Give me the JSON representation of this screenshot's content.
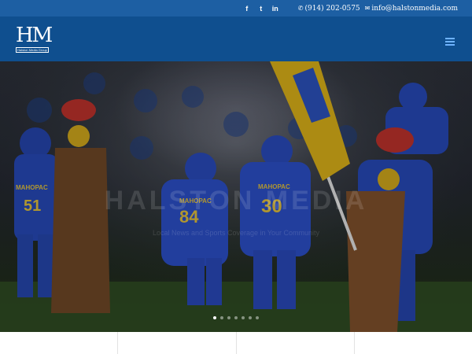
{
  "topbar": {
    "social": [
      {
        "name": "facebook-icon",
        "glyph": "f"
      },
      {
        "name": "twitter-icon",
        "glyph": "t"
      },
      {
        "name": "linkedin-icon",
        "glyph": "in"
      }
    ],
    "phone": "(914) 202-0575",
    "email": "info@halstonmedia.com",
    "bg_color": "#1d5fa3"
  },
  "header": {
    "logo_mark": "HM",
    "logo_sub": "Halston Media Group",
    "bg_color": "#0f4f8f"
  },
  "hero": {
    "title": "HALSTON MEDIA",
    "subtitle": "Local News and Sports Coverage in Your Community",
    "jersey_numbers": [
      "51",
      "84",
      "30"
    ],
    "jersey_text": [
      "MAHOPAC",
      "MAHOPAC",
      "MAHOPAC"
    ],
    "slide_count": 7,
    "active_slide": 1
  }
}
